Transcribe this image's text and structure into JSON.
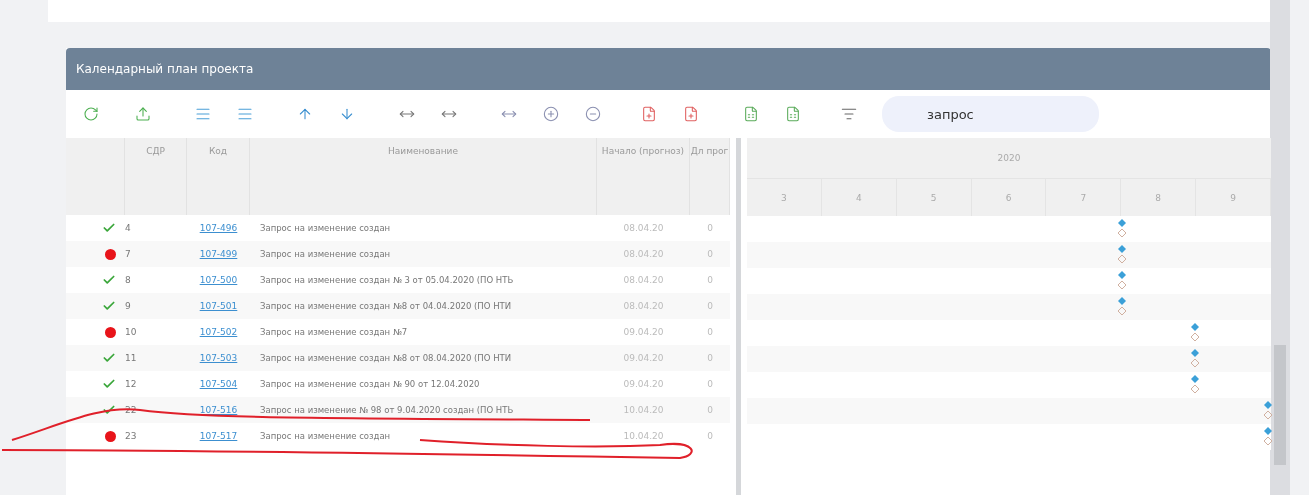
{
  "panel": {
    "title": "Календарный план проекта"
  },
  "search": {
    "value": "запрос"
  },
  "table": {
    "columns": [
      "СДР",
      "Код",
      "Наименование",
      "Начало (прогноз)",
      "Дл прог"
    ],
    "rows": [
      {
        "complete": true,
        "wbs": "4",
        "code": "107-496",
        "name": "Запрос на изменение создан",
        "start": "08.04.20",
        "duration": "0"
      },
      {
        "complete": false,
        "wbs": "7",
        "code": "107-499",
        "name": "Запрос на изменение создан",
        "start": "08.04.20",
        "duration": "0"
      },
      {
        "complete": true,
        "wbs": "8",
        "code": "107-500",
        "name": "Запрос на изменение создан № 3 от 05.04.2020 (ПО НТЬ",
        "start": "08.04.20",
        "duration": "0"
      },
      {
        "complete": true,
        "wbs": "9",
        "code": "107-501",
        "name": "Запрос на изменение создан №8 от 04.04.2020 (ПО НТИ",
        "start": "08.04.20",
        "duration": "0"
      },
      {
        "complete": false,
        "wbs": "10",
        "code": "107-502",
        "name": "Запрос на изменение создан №7",
        "start": "09.04.20",
        "duration": "0"
      },
      {
        "complete": true,
        "wbs": "11",
        "code": "107-503",
        "name": "Запрос на изменение создан №8 от 08.04.2020 (ПО НТИ",
        "start": "09.04.20",
        "duration": "0"
      },
      {
        "complete": true,
        "wbs": "12",
        "code": "107-504",
        "name": "Запрос на изменение создан № 90 от 12.04.2020",
        "start": "09.04.20",
        "duration": "0"
      },
      {
        "complete": true,
        "wbs": "22",
        "code": "107-516",
        "name": "Запрос на изменение № 98 от 9.04.2020 создан (ПО НТЬ",
        "start": "10.04.20",
        "duration": "0"
      },
      {
        "complete": false,
        "wbs": "23",
        "code": "107-517",
        "name": "Запрос на изменение создан",
        "start": "10.04.20",
        "duration": "0"
      }
    ]
  },
  "timeline": {
    "year": "2020",
    "days": [
      "3",
      "4",
      "5",
      "6",
      "7",
      "8",
      "9"
    ]
  }
}
